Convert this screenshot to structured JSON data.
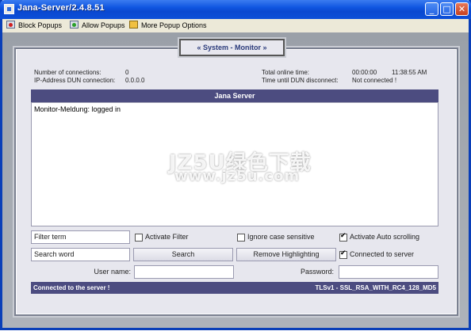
{
  "window": {
    "title": "Jana-Server/2.4.8.51",
    "minimize": "_",
    "maximize": "□",
    "close": "✕"
  },
  "toolbar": {
    "block_popups": "Block Popups",
    "allow_popups": "Allow Popups",
    "more_options": "More Popup Options"
  },
  "tab": {
    "label": "« System - Monitor »"
  },
  "stats": {
    "connections_label": "Number of connections:",
    "connections_value": "0",
    "ip_label": "IP-Address DUN connection:",
    "ip_value": "0.0.0.0",
    "online_time_label": "Total online time:",
    "online_time_value": "00:00:00",
    "clock_value": "11:38:55 AM",
    "disconnect_label": "Time until DUN disconnect:",
    "disconnect_value": "Not connected !"
  },
  "panel": {
    "header": "Jana Server",
    "log_lines": [
      "Monitor-Meldung: logged in"
    ]
  },
  "watermark": {
    "main": "JZ5U绿色下载",
    "sub": "www.jz5u.com"
  },
  "controls": {
    "filter_term_placeholder": "Filter term",
    "activate_filter": "Activate Filter",
    "activate_filter_checked": false,
    "ignore_case": "Ignore case sensitive",
    "ignore_case_checked": false,
    "auto_scrolling": "Activate Auto scrolling",
    "auto_scrolling_checked": true,
    "search_word_placeholder": "Search word",
    "search_button": "Search",
    "remove_highlighting_button": "Remove Highlighting",
    "connected_to_server": "Connected to server",
    "connected_to_server_checked": true,
    "username_label": "User name:",
    "username_value": "",
    "password_label": "Password:",
    "password_value": ""
  },
  "status": {
    "left": "Connected to the server !",
    "right": "TLSv1 - SSL_RSA_WITH_RC4_128_MD5"
  },
  "colors": {
    "title_bar": "#0f55e0",
    "panel_header": "#4c4c80",
    "status_bar": "#4c4c80",
    "frame_bg": "#e7e7ee"
  }
}
